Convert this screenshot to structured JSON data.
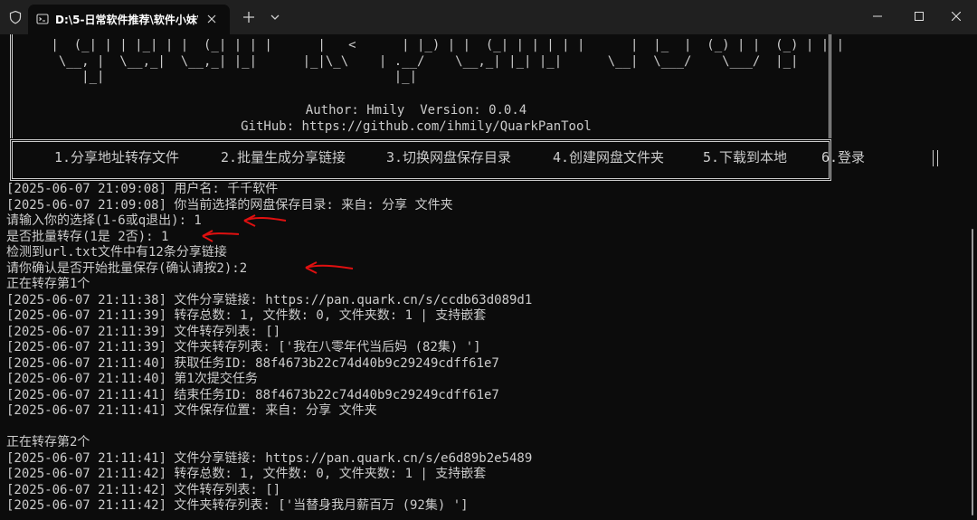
{
  "tab": {
    "title": "D:\\5-日常软件推荐\\软件小妹\\Q"
  },
  "banner": {
    "ascii": [
      " |  (_| | | |_| | |  (_| | | |      |   <      | |_) | |  (_| | | | | |      |  |_  |  (_) | |  (_) | | |",
      "  \\__, |  \\__,_|  \\__,_| |_|      |_|\\_\\    | .__/    \\__,_| |_| |_|      \\__|  \\___/    \\___/  |_|",
      "     |_|                                      |_|"
    ],
    "author_line": "Author: Hmily  Version: 0.0.4",
    "github_line": "GitHub: https://github.com/ihmily/QuarkPanTool"
  },
  "menu": {
    "items": [
      "1.分享地址转存文件",
      "2.批量生成分享链接",
      "3.切换网盘保存目录",
      "4.创建网盘文件夹",
      "5.下载到本地",
      "6.登录"
    ]
  },
  "log": [
    "[2025-06-07 21:09:08] 用户名: 千千软件",
    "[2025-06-07 21:09:08] 你当前选择的网盘保存目录: 来自: 分享 文件夹",
    "请输入你的选择(1-6或q退出): 1",
    "是否批量转存(1是 2否): 1",
    "检测到url.txt文件中有12条分享链接",
    "请你确认是否开始批量保存(确认请按2):2",
    "正在转存第1个",
    "[2025-06-07 21:11:38] 文件分享链接: https://pan.quark.cn/s/ccdb63d089d1",
    "[2025-06-07 21:11:39] 转存总数: 1, 文件数: 0, 文件夹数: 1 | 支持嵌套",
    "[2025-06-07 21:11:39] 文件转存列表: []",
    "[2025-06-07 21:11:39] 文件夹转存列表: ['我在八零年代当后妈 (82集) ']",
    "[2025-06-07 21:11:40] 获取任务ID: 88f4673b22c74d40b9c29249cdff61e7",
    "[2025-06-07 21:11:40] 第1次提交任务",
    "[2025-06-07 21:11:41] 结束任务ID: 88f4673b22c74d40b9c29249cdff61e7",
    "[2025-06-07 21:11:41] 文件保存位置: 来自: 分享 文件夹",
    "",
    "正在转存第2个",
    "[2025-06-07 21:11:41] 文件分享链接: https://pan.quark.cn/s/e6d89b2e5489",
    "[2025-06-07 21:11:42] 转存总数: 1, 文件数: 0, 文件夹数: 1 | 支持嵌套",
    "[2025-06-07 21:11:42] 文件转存列表: []",
    "[2025-06-07 21:11:42] 文件夹转存列表: ['当替身我月薪百万 (92集) ']"
  ],
  "colors": {
    "background": "#0c0c0c",
    "text": "#cccccc",
    "titlebar": "#202020",
    "annotation_arrow": "#e01010"
  }
}
